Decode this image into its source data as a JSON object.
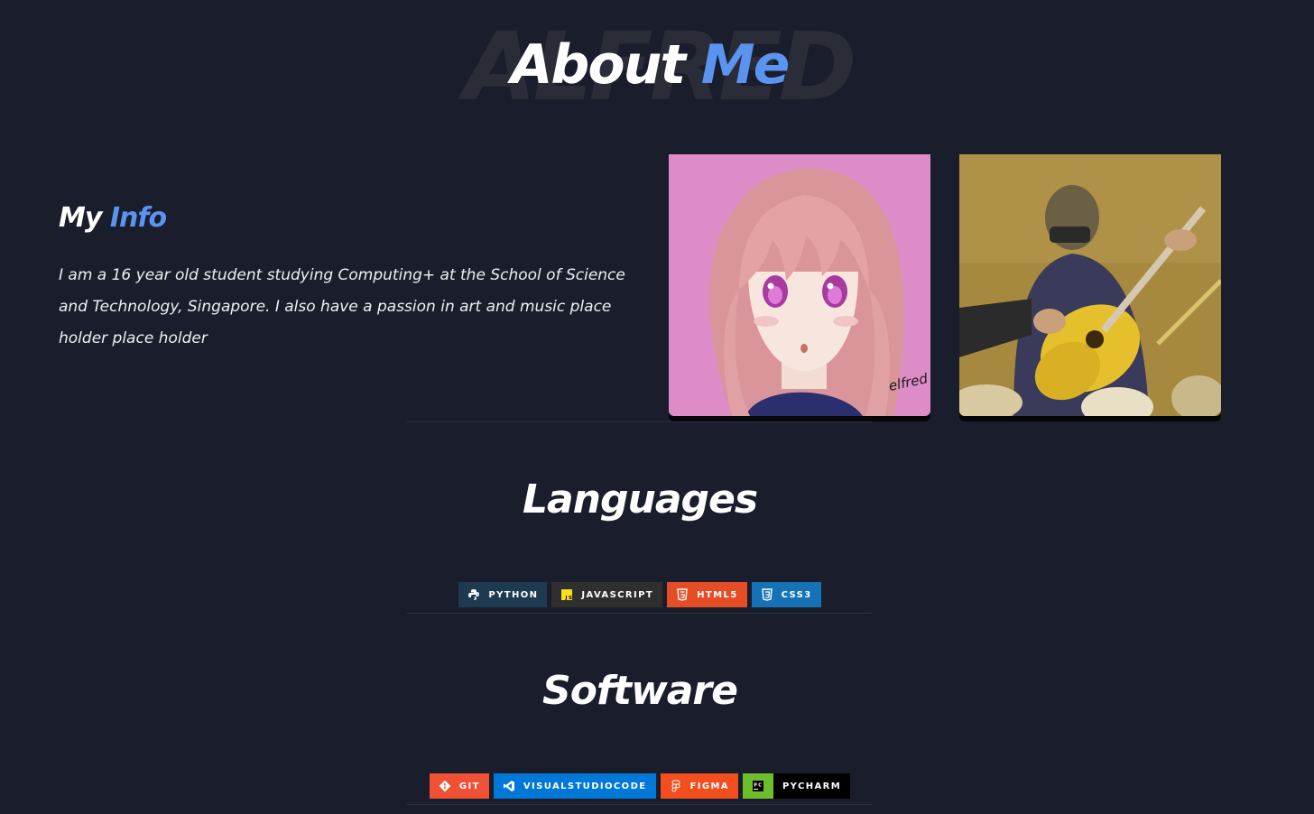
{
  "header": {
    "background_word": "ALFRED",
    "title_main": "About",
    "title_accent": "Me"
  },
  "info": {
    "heading_main": "My",
    "heading_accent": "Info",
    "text": "I am a 16 year old student studying Computing+ at the School of Science and Technology, Singapore. I also have a passion in art and music place holder place holder"
  },
  "photos": {
    "drawing_signature": "elfred"
  },
  "languages": {
    "title": "Languages",
    "badges": [
      {
        "label": "PYTHON",
        "icon": "python-icon",
        "color": "#1e3a50"
      },
      {
        "label": "JAVASCRIPT",
        "icon": "javascript-icon",
        "color": "#2f2f2f"
      },
      {
        "label": "HTML5",
        "icon": "html5-icon",
        "color": "#e44d26"
      },
      {
        "label": "CSS3",
        "icon": "css3-icon",
        "color": "#1572b6"
      }
    ]
  },
  "software": {
    "title": "Software",
    "badges": [
      {
        "label": "GIT",
        "icon": "git-icon",
        "color": "#f05033"
      },
      {
        "label": "VISUALSTUDIOCODE",
        "icon": "vscode-icon",
        "color": "#0078d7"
      },
      {
        "label": "FIGMA",
        "icon": "figma-icon",
        "color": "#f24e1e"
      },
      {
        "label": "PYCHARM",
        "icon": "pycharm-icon",
        "color": "#000000"
      }
    ]
  },
  "colors": {
    "background": "#1a1d2b",
    "accent": "#5a93f0",
    "text": "#ffffff"
  }
}
